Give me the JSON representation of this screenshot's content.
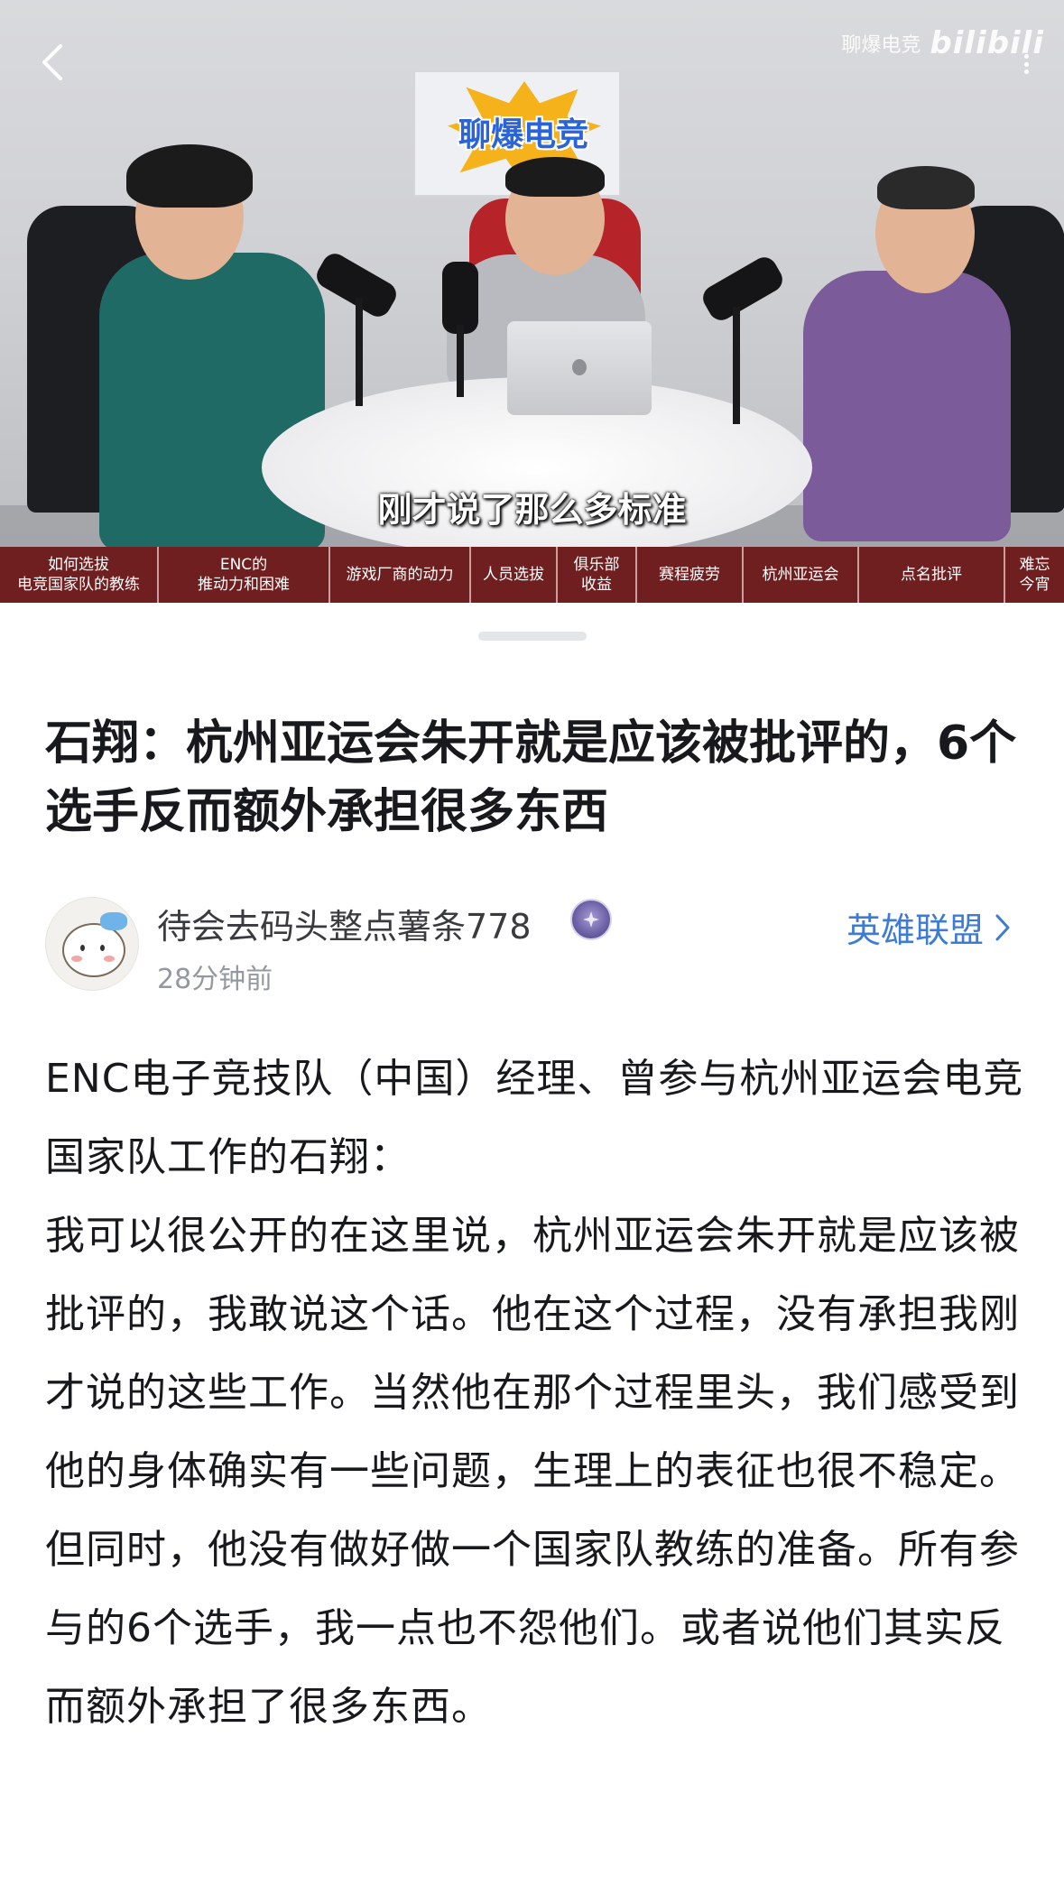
{
  "video": {
    "poster_text": "聊爆电竞",
    "watermark_channel": "聊爆电竞",
    "watermark_brand": "bilibili",
    "subtitle": "刚才说了那么多标准",
    "chapters": [
      "如何选拔\n电竞国家队的教练",
      "ENC的\n推动力和困难",
      "游戏厂商的动力",
      "人员选拔",
      "俱乐部\n收益",
      "赛程疲劳",
      "杭州亚运会",
      "点名批评",
      "难忘\n今宵"
    ]
  },
  "post": {
    "title": "石翔：杭州亚运会朱开就是应该被批评的，6个选手反而额外承担很多东西",
    "author_name": "待会去码头整点薯条778",
    "time": "28分钟前",
    "topic": "英雄联盟",
    "body": "ENC电子竞技队（中国）经理、曾参与杭州亚运会电竞国家队工作的石翔：\n我可以很公开的在这里说，杭州亚运会朱开就是应该被批评的，我敢说这个话。他在这个过程，没有承担我刚才说的这些工作。当然他在那个过程里头，我们感受到他的身体确实有一些问题，生理上的表征也很不稳定。但同时，他没有做好做一个国家队教练的准备。所有参与的6个选手，我一点也不怨他们。或者说他们其实反而额外承担了很多东西。"
  },
  "colors": {
    "chapter_bar": "#6f1f1f",
    "topic_link": "#3d7bd4",
    "secondary_text": "#9499a0"
  },
  "icons": [
    "back-arrow-icon",
    "more-vertical-icon",
    "badge-icon",
    "chevron-right-icon"
  ]
}
